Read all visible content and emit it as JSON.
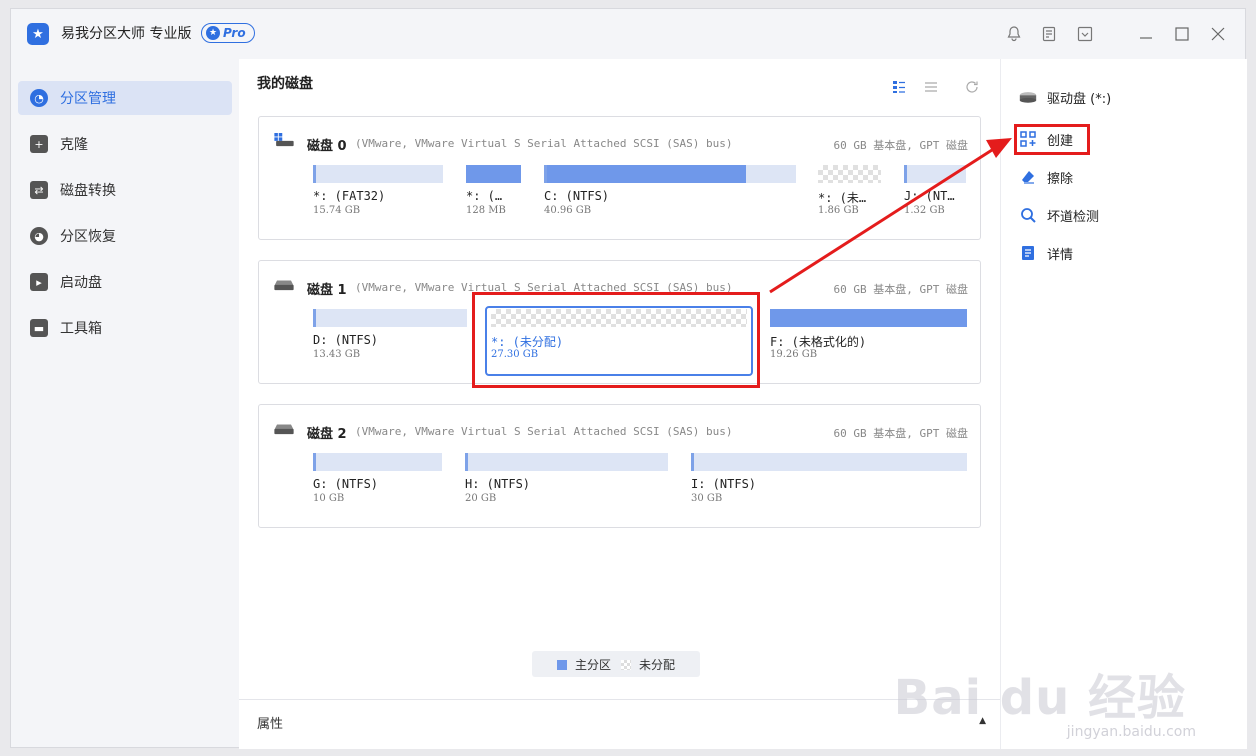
{
  "app": {
    "title": "易我分区大师 专业版",
    "pro_label": "Pro"
  },
  "titlebar_icons": [
    "bell-icon",
    "note-icon",
    "dropdown-icon",
    "minimize-icon",
    "maximize-icon",
    "close-icon"
  ],
  "sidebar": {
    "items": [
      {
        "label": "分区管理",
        "icon": "pie-chart-icon",
        "active": true
      },
      {
        "label": "克隆",
        "icon": "clone-icon",
        "active": false
      },
      {
        "label": "磁盘转换",
        "icon": "convert-icon",
        "active": false
      },
      {
        "label": "分区恢复",
        "icon": "recovery-icon",
        "active": false
      },
      {
        "label": "启动盘",
        "icon": "boot-disk-icon",
        "active": false
      },
      {
        "label": "工具箱",
        "icon": "toolbox-icon",
        "active": false
      }
    ]
  },
  "main": {
    "title": "我的磁盘",
    "disks": [
      {
        "name": "磁盘 0",
        "desc": "(VMware,  VMware Virtual S Serial Attached SCSI (SAS) bus)",
        "summary": "60 GB 基本盘, GPT 磁盘",
        "partitions": [
          {
            "label": "*: (FAT32)",
            "size": "15.74 GB",
            "used_fraction": 0.0,
            "unallocated": false
          },
          {
            "label": "*: (…",
            "size": "128 MB",
            "used_fraction": 1.0,
            "unallocated": false
          },
          {
            "label": "C: (NTFS)",
            "size": "40.96 GB",
            "used_fraction": 0.82,
            "unallocated": false
          },
          {
            "label": "*: (未…",
            "size": "1.86 GB",
            "used_fraction": 0.0,
            "unallocated": true
          },
          {
            "label": "J: (NT…",
            "size": "1.32 GB",
            "used_fraction": 0.0,
            "unallocated": false
          }
        ]
      },
      {
        "name": "磁盘 1",
        "desc": "(VMware,  VMware Virtual S Serial Attached SCSI (SAS) bus)",
        "summary": "60 GB 基本盘, GPT 磁盘",
        "partitions": [
          {
            "label": "D: (NTFS)",
            "size": "13.43 GB",
            "used_fraction": 0.0,
            "unallocated": false
          },
          {
            "label": "*: (未分配)",
            "size": "27.30 GB",
            "used_fraction": 0.0,
            "unallocated": true,
            "selected": true
          },
          {
            "label": "F: (未格式化的)",
            "size": "19.26 GB",
            "used_fraction": 1.0,
            "unallocated": false
          }
        ]
      },
      {
        "name": "磁盘 2",
        "desc": "(VMware,  VMware Virtual S Serial Attached SCSI (SAS) bus)",
        "summary": "60 GB 基本盘, GPT 磁盘",
        "partitions": [
          {
            "label": "G: (NTFS)",
            "size": "10 GB",
            "used_fraction": 0.0,
            "unallocated": false
          },
          {
            "label": "H: (NTFS)",
            "size": "20 GB",
            "used_fraction": 0.0,
            "unallocated": false
          },
          {
            "label": "I: (NTFS)",
            "size": "30 GB",
            "used_fraction": 0.0,
            "unallocated": false
          }
        ]
      }
    ],
    "legend": {
      "primary": "主分区",
      "unallocated": "未分配"
    },
    "properties_label": "属性"
  },
  "right_panel": {
    "drive_label": "驱动盘  (*:)",
    "operations": [
      {
        "label": "创建",
        "icon": "create-grid-icon"
      },
      {
        "label": "擦除",
        "icon": "eraser-icon"
      },
      {
        "label": "坏道检测",
        "icon": "scan-icon"
      },
      {
        "label": "详情",
        "icon": "details-icon"
      }
    ]
  },
  "colors": {
    "accent": "#2f6fe0",
    "primary_partition": "#6f98ea",
    "annotation_red": "#e41c1c"
  },
  "watermark": {
    "brand": "Bai du 经验",
    "url": "jingyan.baidu.com"
  }
}
